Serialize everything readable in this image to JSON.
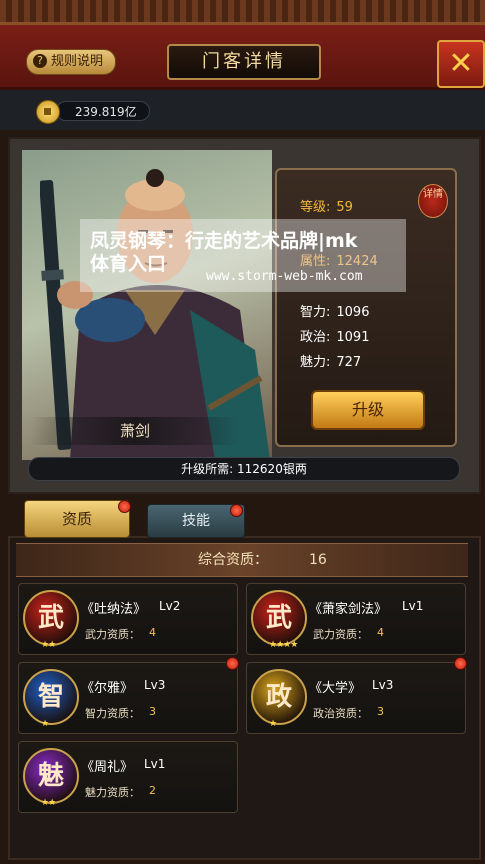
{
  "header": {
    "rules_label": "规则说明",
    "rules_icon": "question-icon",
    "title": "门客详情",
    "close_icon": "close-icon",
    "close_glyph": "✕"
  },
  "currency": {
    "icon": "coin-icon",
    "value": "239.819亿"
  },
  "retainer": {
    "name": "萧剑",
    "detail_label": "详情",
    "stats": [
      {
        "label": "等级:",
        "value": "59",
        "color": "#f4b63a"
      },
      {
        "label": "属性:",
        "value": "12424",
        "color": "#ffffff"
      },
      {
        "label": "智力:",
        "value": "1096",
        "color": "#ffffff"
      },
      {
        "label": "政治:",
        "value": "1091",
        "color": "#ffffff"
      },
      {
        "label": "魅力:",
        "value": "727",
        "color": "#ffffff"
      }
    ],
    "upgrade_label": "升级",
    "cost_label": "升级所需: 112620银两"
  },
  "watermark": {
    "line1": "凤灵钢琴：行走的艺术品牌|mk",
    "line2": "体育入口",
    "url": "www.storm-web-mk.com"
  },
  "tabs": [
    {
      "label": "资质",
      "active": true,
      "has_dot": true
    },
    {
      "label": "技能",
      "active": false,
      "has_dot": true
    }
  ],
  "summary": {
    "label": "综合资质：",
    "value": "16"
  },
  "books": [
    {
      "emblem": "武",
      "emblem_icon": "martial-emblem-icon",
      "color": "#c8231b",
      "stars": "★★",
      "name": "《吐纳法》",
      "lv": "Lv2",
      "attr": "武力资质：",
      "value": "4",
      "dot": false
    },
    {
      "emblem": "武",
      "emblem_icon": "martial-emblem-icon",
      "color": "#c8231b",
      "stars": "★★★★",
      "name": "《萧家剑法》",
      "lv": "Lv1",
      "attr": "武力资质：",
      "value": "4",
      "dot": false
    },
    {
      "emblem": "智",
      "emblem_icon": "wisdom-emblem-icon",
      "color": "#1f5fc8",
      "stars": "★",
      "name": "《尔雅》",
      "lv": "Lv3",
      "attr": "智力资质：",
      "value": "3",
      "dot": true
    },
    {
      "emblem": "政",
      "emblem_icon": "politics-emblem-icon",
      "color": "#d8a51b",
      "stars": "★",
      "name": "《大学》",
      "lv": "Lv3",
      "attr": "政治资质：",
      "value": "3",
      "dot": true
    },
    {
      "emblem": "魅",
      "emblem_icon": "charm-emblem-icon",
      "color": "#8a2bc8",
      "stars": "★★",
      "name": "《周礼》",
      "lv": "Lv1",
      "attr": "魅力资质：",
      "value": "2",
      "dot": false
    }
  ]
}
